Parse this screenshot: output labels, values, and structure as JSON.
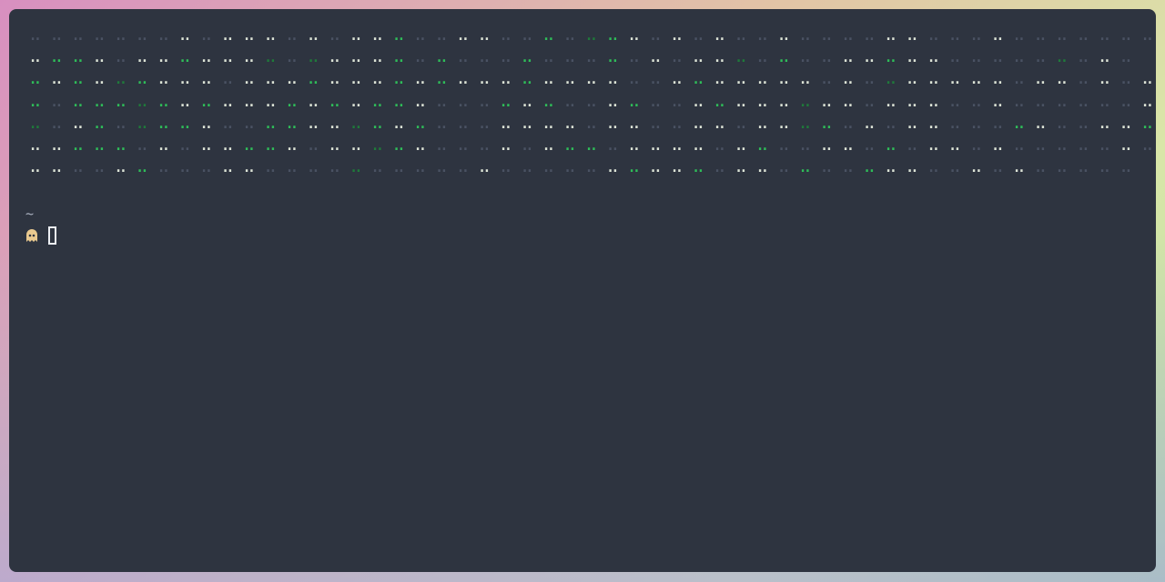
{
  "terminal": {
    "glyph": "ꓺ",
    "palette": {
      "dim": "#4a5263",
      "light": "#dce3d6",
      "bright": "#2ebd59",
      "dark": "#1f7a3a"
    },
    "rows": [
      "dddddddLdLLLdLdLLGddLLddGdbGLdLdLddLddddLLdddLddddddd",
      "LGGLdLLGLLLbdbLLLGdGdddGdddGdLdLLbdGddLLGLLdddddbdLd",
      "GLGLbGLLLdLLLGLLLGLGLLLGLLLLddLGLLLLLdLdbLLLLLdLLdLdL",
      "GdGGGbGLGLLLGLGLGGLdddGLGddLGddLGLLLbLLdLLLddLddddddLd",
      "bdLGdbGGLddGGLLbGLGdddLLLLdLLddLLdLLbGdLdLLdddGLddLLG",
      "LLGGGdLdLLGGLdLLbGLdddLdLGGdLLLLdLGddLLdGdLLdLdddddLd",
      "LLddLGdddLLddddbdddddLdddddLGLLGdLLdGddGLLddLdLddddd"
    ]
  },
  "prompt": {
    "dir": "~",
    "icon": "ghost-icon"
  }
}
